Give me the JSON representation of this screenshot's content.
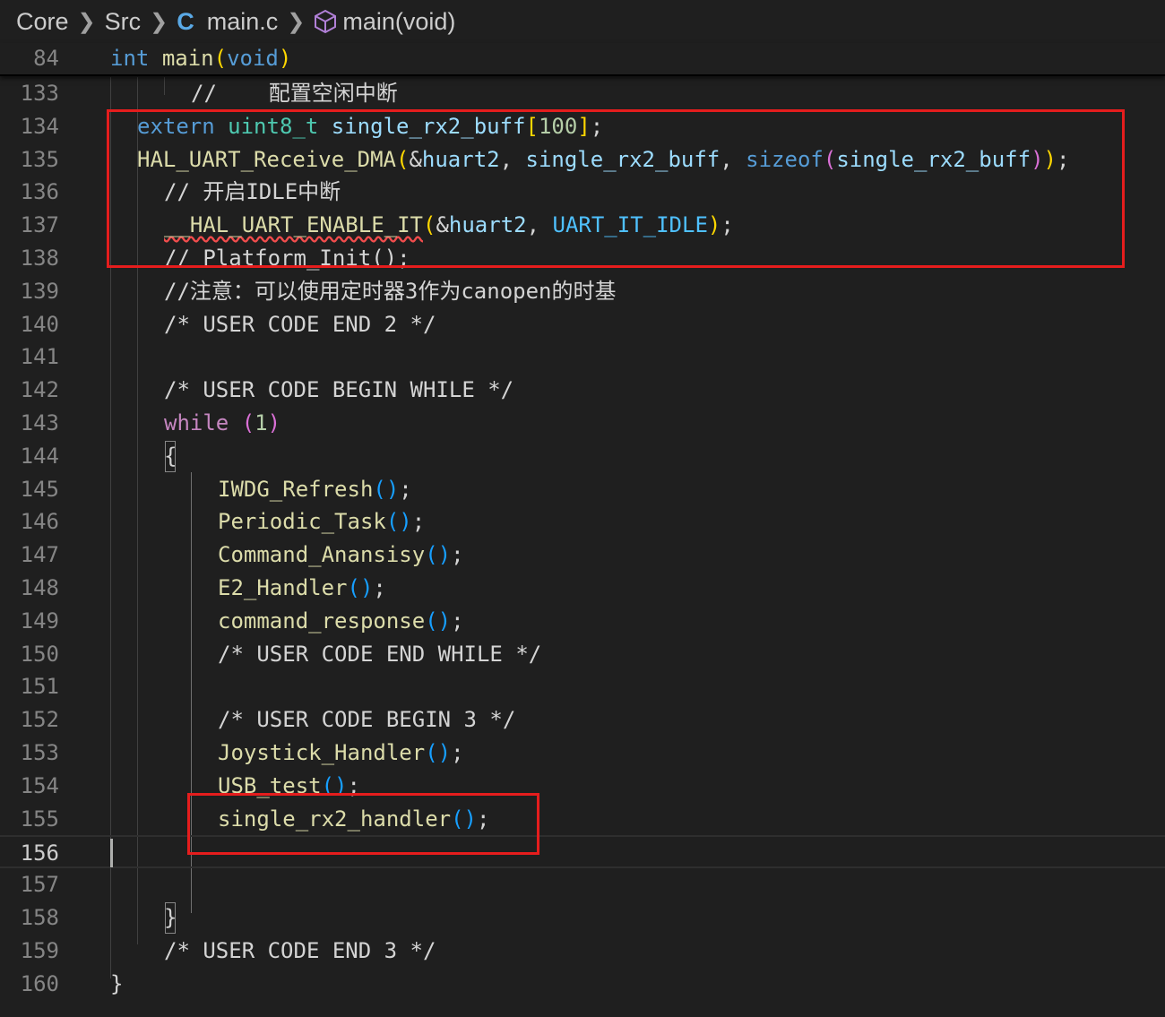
{
  "breadcrumb": {
    "folder1": "Core",
    "folder2": "Src",
    "file_icon": "C",
    "file": "main.c",
    "symbol": "main(void)"
  },
  "sticky": {
    "line": "84",
    "kw_int": "int",
    "fn_main": "main",
    "paren_open": "(",
    "kw_void": "void",
    "paren_close": ")"
  },
  "lines": {
    "l133": "133",
    "l134": "134",
    "l135": "135",
    "l136": "136",
    "l137": "137",
    "l138": "138",
    "l139": "139",
    "l140": "140",
    "l141": "141",
    "l142": "142",
    "l143": "143",
    "l144": "144",
    "l145": "145",
    "l146": "146",
    "l147": "147",
    "l148": "148",
    "l149": "149",
    "l150": "150",
    "l151": "151",
    "l152": "152",
    "l153": "153",
    "l154": "154",
    "l155": "155",
    "l156": "156",
    "l157": "157",
    "l158": "158",
    "l159": "159",
    "l160": "160"
  },
  "code": {
    "c133": "//    配置空闲中断",
    "c134_extern": "extern",
    "c134_type": "uint8_t",
    "c134_var": "single_rx2_buff",
    "c134_lb": "[",
    "c134_num": "100",
    "c134_rb": "]",
    "c134_semi": ";",
    "c135_fn": "HAL_UART_Receive_DMA",
    "c135_lp": "(",
    "c135_amp": "&",
    "c135_huart": "huart2",
    "c135_comma1": ", ",
    "c135_buf": "single_rx2_buff",
    "c135_comma2": ", ",
    "c135_sizeof": "sizeof",
    "c135_lp2": "(",
    "c135_buf2": "single_rx2_buff",
    "c135_rp2": ")",
    "c135_rp": ")",
    "c135_semi": ";",
    "c136": "// 开启IDLE中断",
    "c137_fn": "__HAL_UART_ENABLE_IT",
    "c137_lp": "(",
    "c137_amp": "&",
    "c137_huart": "huart2",
    "c137_comma": ", ",
    "c137_mac": "UART_IT_IDLE",
    "c137_rp": ")",
    "c137_semi": ";",
    "c138": "// Platform_Init();",
    "c139": "//注意：可以使用定时器3作为canopen的时基",
    "c140": "/* USER CODE END 2 */",
    "c142": "/* USER CODE BEGIN WHILE */",
    "c143_kw": "while",
    "c143_lp": "(",
    "c143_num": "1",
    "c143_rp": ")",
    "c144": "{",
    "c145_fn": "IWDG_Refresh",
    "c146_fn": "Periodic_Task",
    "c147_fn": "Command_Anansisy",
    "c148_fn": "E2_Handler",
    "c149_fn": "command_response",
    "c150": "/* USER CODE END WHILE */",
    "c152": "/* USER CODE BEGIN 3 */",
    "c153_fn": "Joystick_Handler",
    "c154_fn": "USB_test",
    "c155_fn": "single_rx2_handler",
    "call_parens": "()",
    "semi": ";",
    "c158": "}",
    "c159": "/* USER CODE END 3 */",
    "c160": "}"
  },
  "colors": {
    "background": "#1f1f1f",
    "keyword": "#569cd6",
    "control": "#c586c0",
    "type": "#4ec9b0",
    "function": "#dcdcaa",
    "variable": "#9cdcfe",
    "comment": "#6a9955",
    "number": "#b5cea8",
    "highlight_box": "#e51d1d"
  }
}
